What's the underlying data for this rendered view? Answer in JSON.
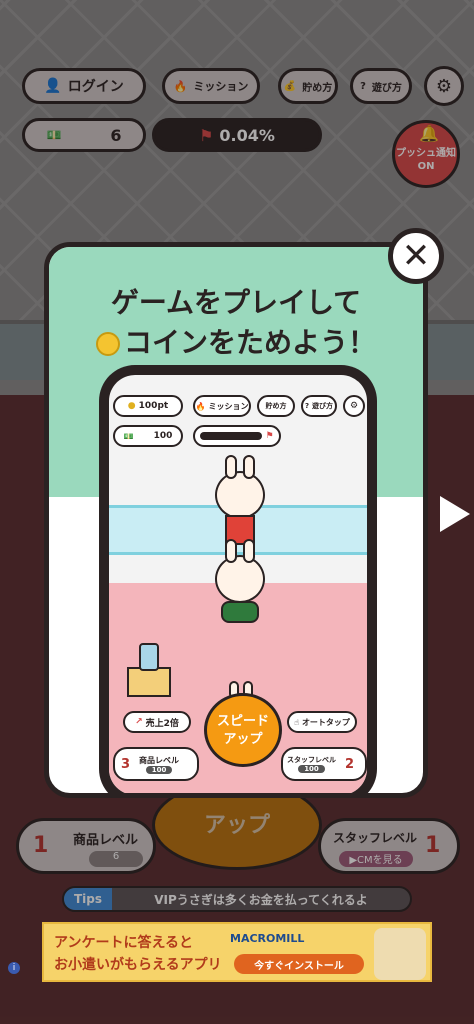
{
  "header": {
    "login_label": "ログイン",
    "mission_label": "ミッション",
    "save_label": "貯め方",
    "howto_label": "遊び方",
    "cash_value": "6",
    "progress_value": "0.04%",
    "push_label_line1": "プッシュ通知",
    "push_label_line2": "ON"
  },
  "modal": {
    "title_line1": "ゲームをプレイして",
    "title_line2": "コインをためよう！",
    "close_label": "✕"
  },
  "mini_game": {
    "points_value": "100pt",
    "mission_label": "ミッション",
    "save_label": "貯め方",
    "howto_label": "遊び方",
    "cash_value": "100",
    "sales_label": "売上2倍",
    "autotap_label": "オートタップ",
    "speed_label_line1": "スピード",
    "speed_label_line2": "アップ",
    "product_level_label": "商品レベル",
    "product_level_value": "3",
    "product_level_cost": "100",
    "staff_level_label": "スタッフレベル",
    "staff_level_value": "2",
    "staff_level_cost": "100"
  },
  "bottom": {
    "speed_label": "アップ",
    "product_level_label": "商品レベル",
    "product_level_value": "1",
    "product_level_cost": "6",
    "staff_level_label": "スタッフレベル",
    "staff_level_value": "1",
    "staff_cm_label": "▶CMを見る"
  },
  "tips": {
    "tag": "Tips",
    "text": "VIPうさぎは多くお金を払ってくれるよ"
  },
  "ad": {
    "line1": "アンケートに答えると",
    "line2": "お小遣いがもらえるアプリ",
    "brand": "MACROMILL",
    "install_label": "今すぐインストール"
  },
  "colors": {
    "modal_header": "#9ad9bd",
    "mini_floor": "#f4b5bb",
    "speed_button": "#f59a12",
    "push_button": "#d84949"
  }
}
